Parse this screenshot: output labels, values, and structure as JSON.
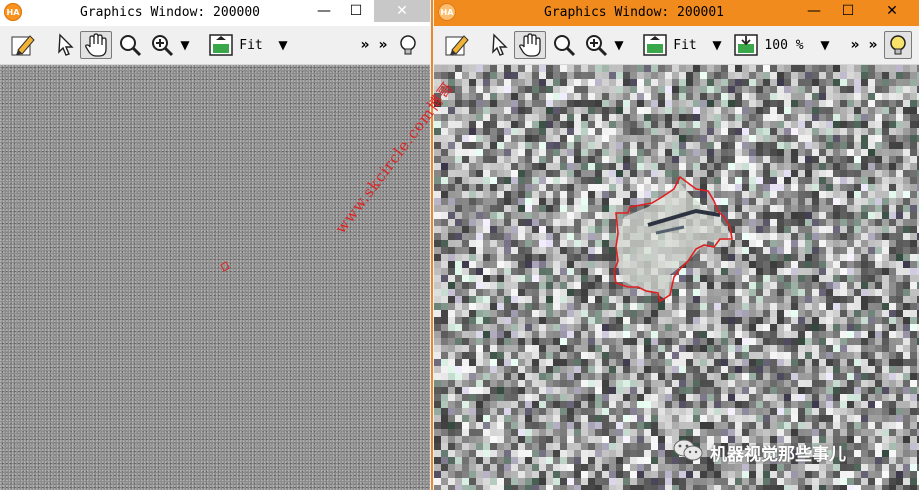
{
  "left_window": {
    "app_icon": "HA",
    "title": "Graphics Window: 200000",
    "minimize_label": "—",
    "maximize_label": "☐",
    "close_label": "✕",
    "zoom_mode": "Fit"
  },
  "right_window": {
    "app_icon": "HA",
    "title": "Graphics Window: 200001",
    "minimize_label": "—",
    "maximize_label": "☐",
    "close_label": "✕",
    "zoom_mode": "Fit",
    "zoom_percent": "100 %"
  },
  "toolbar_common": {
    "chevron": "▼",
    "more": "»"
  },
  "watermark": "www.skcircle.com博哥",
  "footer_brand": "机器视觉那些事儿",
  "colors": {
    "left_titlebar": "#ffffff",
    "right_titlebar": "#f28b1e",
    "region_outline": "#e02020",
    "window_divider": "#e8892a"
  },
  "icons": [
    "edit-icon",
    "pointer-icon",
    "hand-pan-icon",
    "magnifier-icon",
    "zoom-in-icon",
    "fit-window-icon",
    "zoom-percent-icon",
    "lightbulb-icon"
  ]
}
